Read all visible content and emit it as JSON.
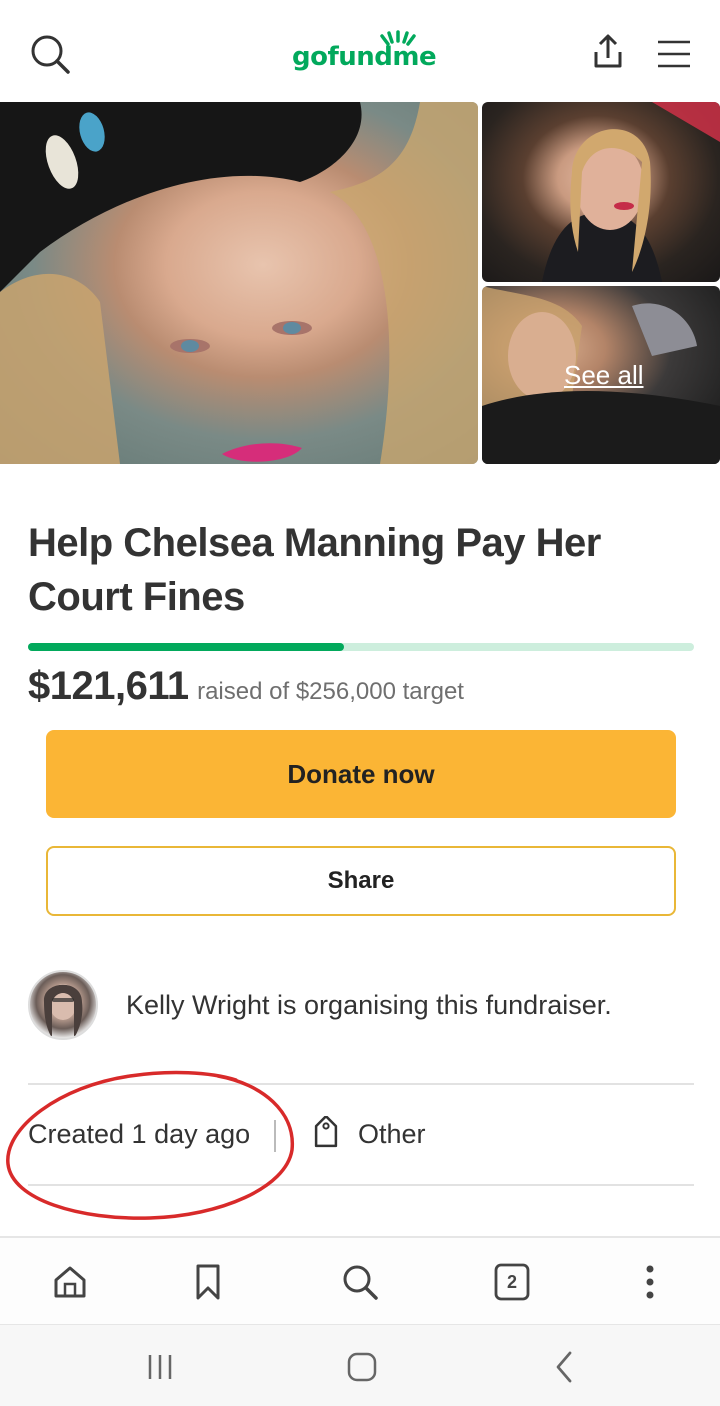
{
  "header": {
    "logo_text": "gofundme",
    "icons": [
      "search-icon",
      "share-upload-icon",
      "hamburger-menu-icon"
    ],
    "brand_color": "#02a95c"
  },
  "gallery": {
    "see_all_label": "See all"
  },
  "campaign": {
    "title": "Help Chelsea Manning Pay Her Court Fines",
    "amount_raised": "$121,611",
    "raised_text": "raised of $256,000 target",
    "progress_fraction": 0.475
  },
  "actions": {
    "donate_label": "Donate now",
    "share_label": "Share",
    "donate_color": "#fbb535"
  },
  "organiser": {
    "text": "Kelly Wright is organising this fundraiser."
  },
  "meta": {
    "created_text": "Created 1 day ago",
    "category": "Other"
  },
  "browser_toolbar": {
    "icons": [
      "home-icon",
      "bookmark-icon",
      "search-icon",
      "tabs-icon",
      "more-options-icon"
    ],
    "tab_count": "2"
  },
  "system_nav": {
    "icons": [
      "recent-apps-icon",
      "home-button-icon",
      "back-icon"
    ]
  }
}
